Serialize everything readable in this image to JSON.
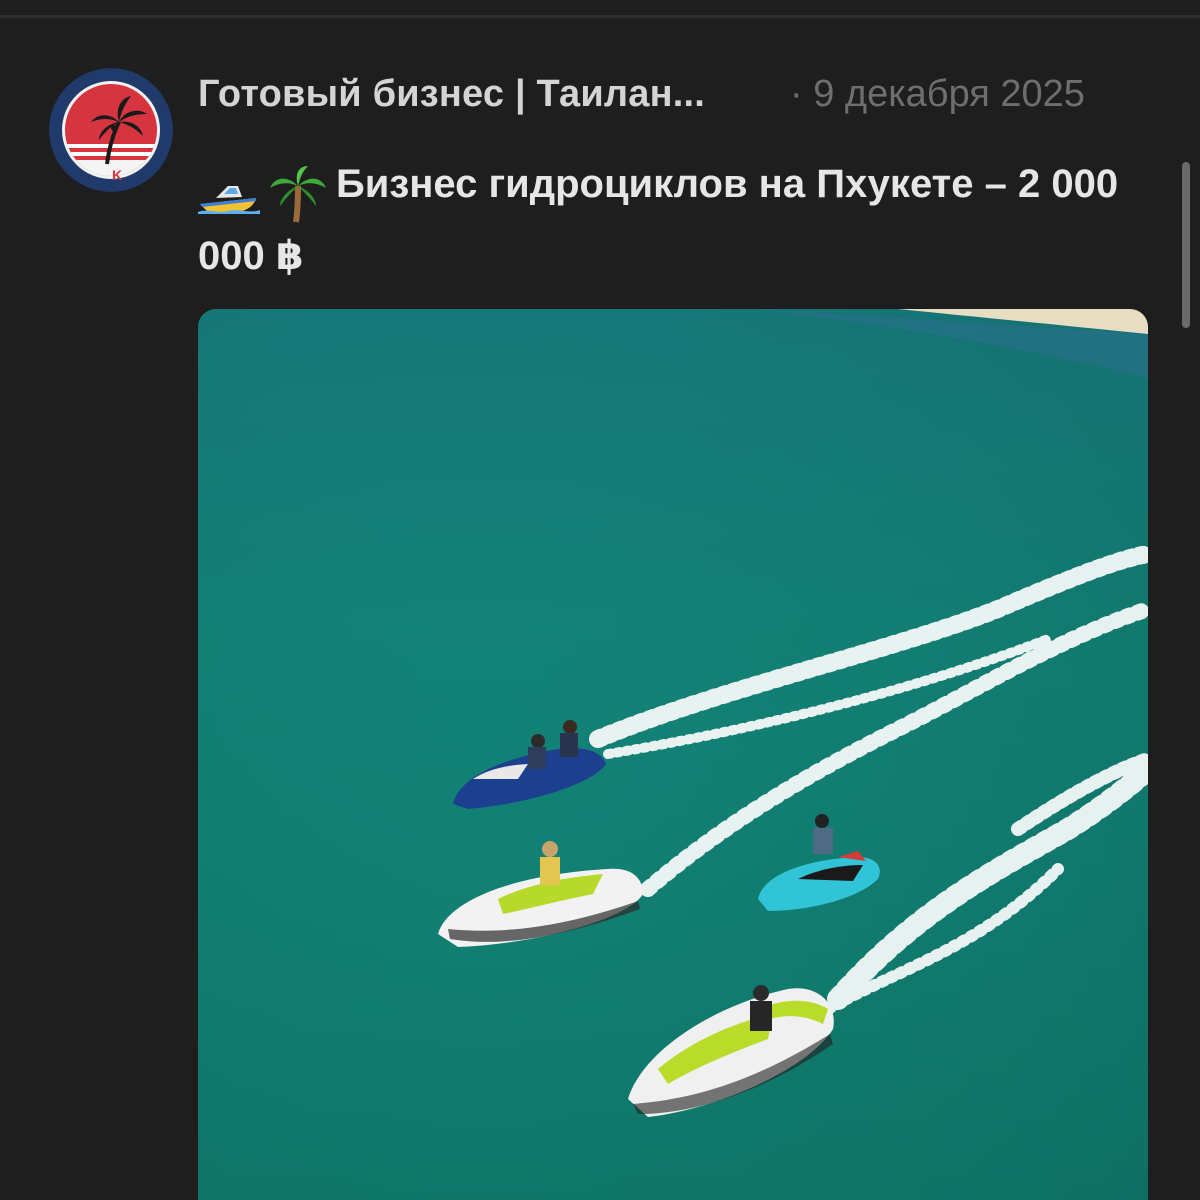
{
  "post": {
    "channel_name": "Готовый бизнес | Таилан...",
    "date": "· 9 декабря 2025",
    "title": "Бизнес гидроциклов на Пхукете – 2 000 000 ฿",
    "title_emojis": [
      "speedboat-icon",
      "palm-tree-icon"
    ]
  },
  "avatar": {
    "icon": "palm-tree-sunset-logo",
    "letter": "K",
    "colors": {
      "ring": "#1f3a6b",
      "sky": "#d6353f",
      "stripes": "#ffffff"
    }
  },
  "media": {
    "type": "photo",
    "colors": {
      "water": "#16877a",
      "shore": "#e7ddc3"
    }
  }
}
